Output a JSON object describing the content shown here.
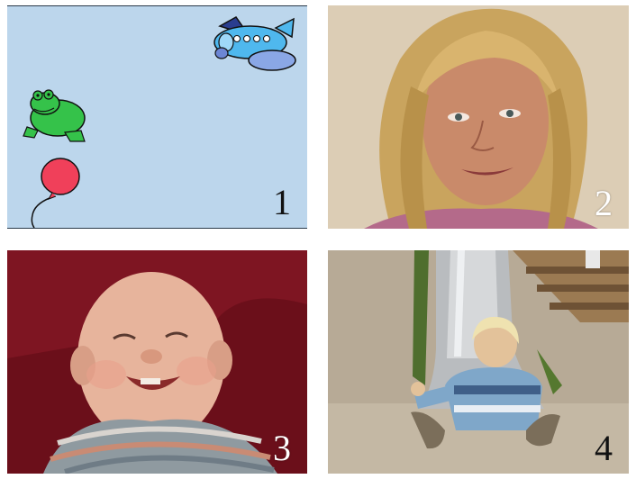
{
  "panels": [
    {
      "number": "1",
      "content": "illustration"
    },
    {
      "number": "2",
      "content": "photo"
    },
    {
      "number": "3",
      "content": "photo"
    },
    {
      "number": "4",
      "content": "photo"
    }
  ],
  "colors": {
    "panel1_background": "#bcd6ec",
    "panel3_background": "#6a0f18"
  }
}
